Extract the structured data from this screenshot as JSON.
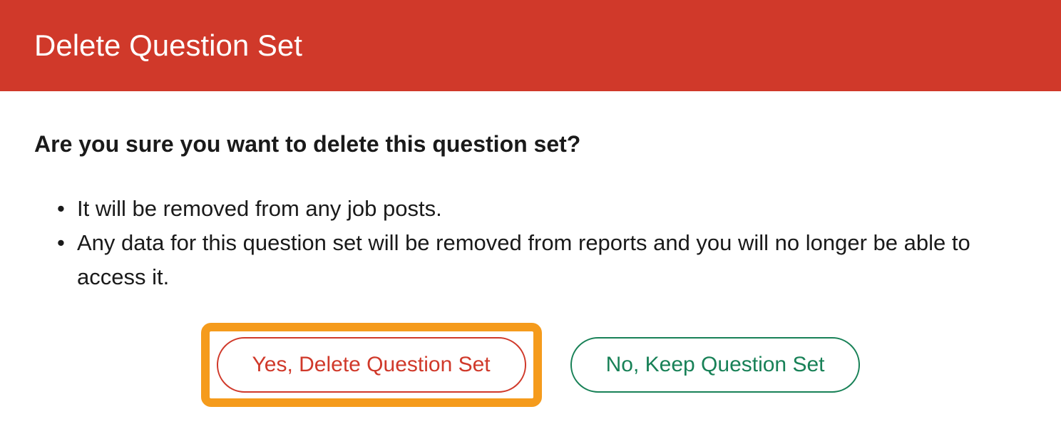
{
  "dialog": {
    "title": "Delete Question Set",
    "confirm_text": "Are you sure you want to delete this question set?",
    "bullets": {
      "b1": "It will be removed from any job posts.",
      "b2": "Any data for this question set will be removed from reports and you will no longer be able to access it."
    },
    "buttons": {
      "delete": "Yes, Delete Question Set",
      "keep": "No, Keep Question Set"
    }
  }
}
